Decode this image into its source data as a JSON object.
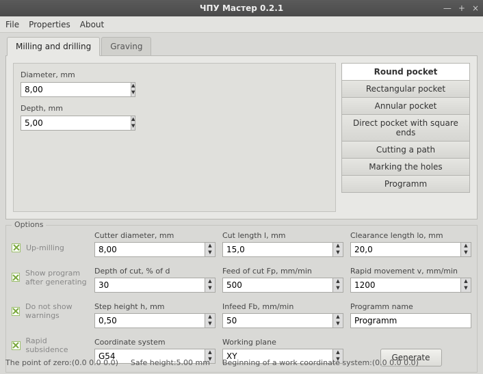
{
  "window": {
    "title": "ЧПУ Мастер 0.2.1"
  },
  "menu": {
    "file": "File",
    "properties": "Properties",
    "about": "About"
  },
  "tabs": {
    "milling": "Milling and drilling",
    "graving": "Graving"
  },
  "left": {
    "diameter_label": "Diameter, mm",
    "diameter_val": "8,00",
    "depth_label": "Depth, mm",
    "depth_val": "5,00"
  },
  "ops": [
    "Round pocket",
    "Rectangular pocket",
    "Annular pocket",
    "Direct pocket with square ends",
    "Cutting a path",
    "Marking the holes",
    "Programm"
  ],
  "options_legend": "Options",
  "checks": {
    "up_milling": "Up-milling",
    "show_prog": "Show program after generating",
    "no_warn": "Do not show warnings",
    "rapid_sub": "Rapid subsidence"
  },
  "grid": {
    "cutter_d_lbl": "Cutter diameter, mm",
    "cutter_d": "8,00",
    "cut_len_lbl": "Cut length l, mm",
    "cut_len": "15,0",
    "clr_len_lbl": "Clearance length lo, mm",
    "clr_len": "20,0",
    "doc_lbl": "Depth of cut, % of d",
    "doc": "30",
    "feed_lbl": "Feed of cut Fp, mm/min",
    "feed": "500",
    "rapid_lbl": "Rapid movement v, mm/min",
    "rapid": "1200",
    "step_lbl": "Step height h, mm",
    "step": "0,50",
    "infeed_lbl": "Infeed Fb, mm/min",
    "infeed": "50",
    "prog_name_lbl": "Programm name",
    "prog_name": "Programm",
    "coord_lbl": "Coordinate system",
    "coord": "G54",
    "plane_lbl": "Working plane",
    "plane": "XY",
    "generate": "Generate"
  },
  "status": {
    "zero": "The point of zero:(0.0  0.0  0.0)",
    "safe": "Safe height:5.00 mm",
    "wcs": "Beginning of a work coordinate system:(0.0  0.0  0.0)"
  }
}
